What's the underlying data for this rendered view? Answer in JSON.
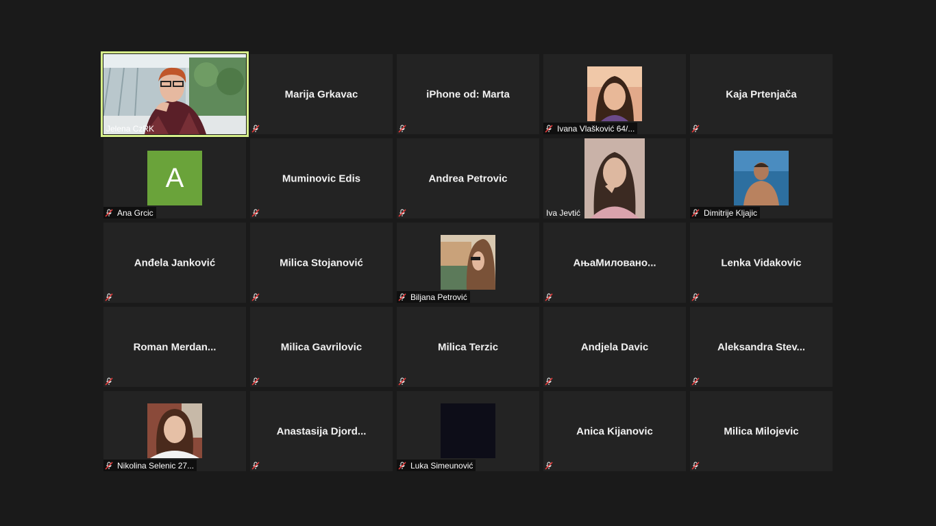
{
  "meeting": {
    "view": "gallery",
    "muted_icon": "mic-muted-icon",
    "accent_speaker_border": "#d7f08a",
    "avatar_color": "#6aa33a"
  },
  "participants": [
    {
      "name": "Jelena CzRK",
      "type": "video",
      "active_speaker": true,
      "muted": false
    },
    {
      "name": "Marija Grkavac",
      "type": "name",
      "muted": true
    },
    {
      "name": "iPhone od: Marta",
      "type": "name",
      "muted": true
    },
    {
      "name": "Ivana Vlašković 64/...",
      "type": "photo",
      "muted": true
    },
    {
      "name": "Kaja Prtenjača",
      "type": "name",
      "muted": true
    },
    {
      "name": "Ana Grcic",
      "type": "avatar",
      "letter": "A",
      "muted": true
    },
    {
      "name": "Muminovic Edis",
      "type": "name",
      "muted": true
    },
    {
      "name": "Andrea Petrovic",
      "type": "name",
      "muted": true
    },
    {
      "name": "Iva Jevtić",
      "type": "photo",
      "muted": false
    },
    {
      "name": "Dimitrije Kljajic",
      "type": "photo",
      "muted": true
    },
    {
      "name": "Anđela Janković",
      "type": "name",
      "muted": true
    },
    {
      "name": "Milica Stojanović",
      "type": "name",
      "muted": true
    },
    {
      "name": "Biljana Petrović",
      "type": "photo",
      "muted": true
    },
    {
      "name": "АњаМилованo...",
      "type": "name",
      "muted": true
    },
    {
      "name": "Lenka Vidakovic",
      "type": "name",
      "muted": true
    },
    {
      "name": "Roman  Merdan...",
      "type": "name",
      "muted": true
    },
    {
      "name": "Milica Gavrilovic",
      "type": "name",
      "muted": true
    },
    {
      "name": "Milica Terzic",
      "type": "name",
      "muted": true
    },
    {
      "name": "Andjela Davic",
      "type": "name",
      "muted": true
    },
    {
      "name": "Aleksandra  Stev...",
      "type": "name",
      "muted": true
    },
    {
      "name": "Nikolina Selenic 27...",
      "type": "photo",
      "muted": true
    },
    {
      "name": "Anastasija  Djord...",
      "type": "name",
      "muted": true
    },
    {
      "name": "Luka Simeunović",
      "type": "photo",
      "muted": true
    },
    {
      "name": "Anica Kijanovic",
      "type": "name",
      "muted": true
    },
    {
      "name": "Milica Milojevic",
      "type": "name",
      "muted": true
    }
  ]
}
